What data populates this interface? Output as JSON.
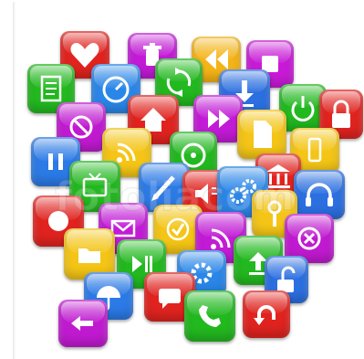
{
  "image": {
    "subject": "",
    "watermark_text": "fotoliacom"
  },
  "tiles": [
    {
      "name": "heart-icon",
      "color": "#e0231f"
    },
    {
      "name": "trash-icon",
      "color": "#c21bd6"
    },
    {
      "name": "rewind-icon",
      "color": "#f4b316"
    },
    {
      "name": "stop-icon",
      "color": "#c81ad6"
    },
    {
      "name": "document-icon",
      "color": "#22b81f"
    },
    {
      "name": "gauge-icon",
      "color": "#2a86e8"
    },
    {
      "name": "refresh-icon",
      "color": "#22b81f"
    },
    {
      "name": "download-icon",
      "color": "#2b6fe0"
    },
    {
      "name": "power-icon",
      "color": "#22b81f"
    },
    {
      "name": "lock-icon",
      "color": "#e0231f"
    },
    {
      "name": "forbidden-icon",
      "color": "#c01ad0"
    },
    {
      "name": "home-icon",
      "color": "#e0231f"
    },
    {
      "name": "fast-forward-icon",
      "color": "#c21bd6"
    },
    {
      "name": "file-icon",
      "color": "#f4c516"
    },
    {
      "name": "phone-icon",
      "color": "#f4c516"
    },
    {
      "name": "pause-icon",
      "color": "#2b7ae6"
    },
    {
      "name": "rss-icon",
      "color": "#f4c516"
    },
    {
      "name": "disc-icon",
      "color": "#22b81f"
    },
    {
      "name": "bank-icon",
      "color": "#e0231f"
    },
    {
      "name": "tv-icon",
      "color": "#22b81f"
    },
    {
      "name": "pencil-icon",
      "color": "#2b7ae6"
    },
    {
      "name": "speaker-icon",
      "color": "#e0231f"
    },
    {
      "name": "gears-icon",
      "color": "#2a86e8"
    },
    {
      "name": "headphones-icon",
      "color": "#2b6fe0"
    },
    {
      "name": "user-icon",
      "color": "#e0231f"
    },
    {
      "name": "mail-icon",
      "color": "#c21bd6"
    },
    {
      "name": "check-icon",
      "color": "#f4c516"
    },
    {
      "name": "rss-icon-2",
      "color": "#c21bd6"
    },
    {
      "name": "key-icon",
      "color": "#f4c516"
    },
    {
      "name": "close-circle-icon",
      "color": "#c01ad0"
    },
    {
      "name": "folder-icon",
      "color": "#f4c516"
    },
    {
      "name": "play-pause-icon",
      "color": "#22b81f"
    },
    {
      "name": "settings-icon",
      "color": "#2a86e8"
    },
    {
      "name": "upload-icon",
      "color": "#22b81f"
    },
    {
      "name": "unlock-icon",
      "color": "#2b6fe0"
    },
    {
      "name": "umbrella-icon",
      "color": "#2b7ae6"
    },
    {
      "name": "chat-icon",
      "color": "#e0231f"
    },
    {
      "name": "phone-call-icon",
      "color": "#22b81f"
    },
    {
      "name": "undo-icon",
      "color": "#e0231f"
    },
    {
      "name": "back-arrow-icon",
      "color": "#c01ad0"
    }
  ]
}
